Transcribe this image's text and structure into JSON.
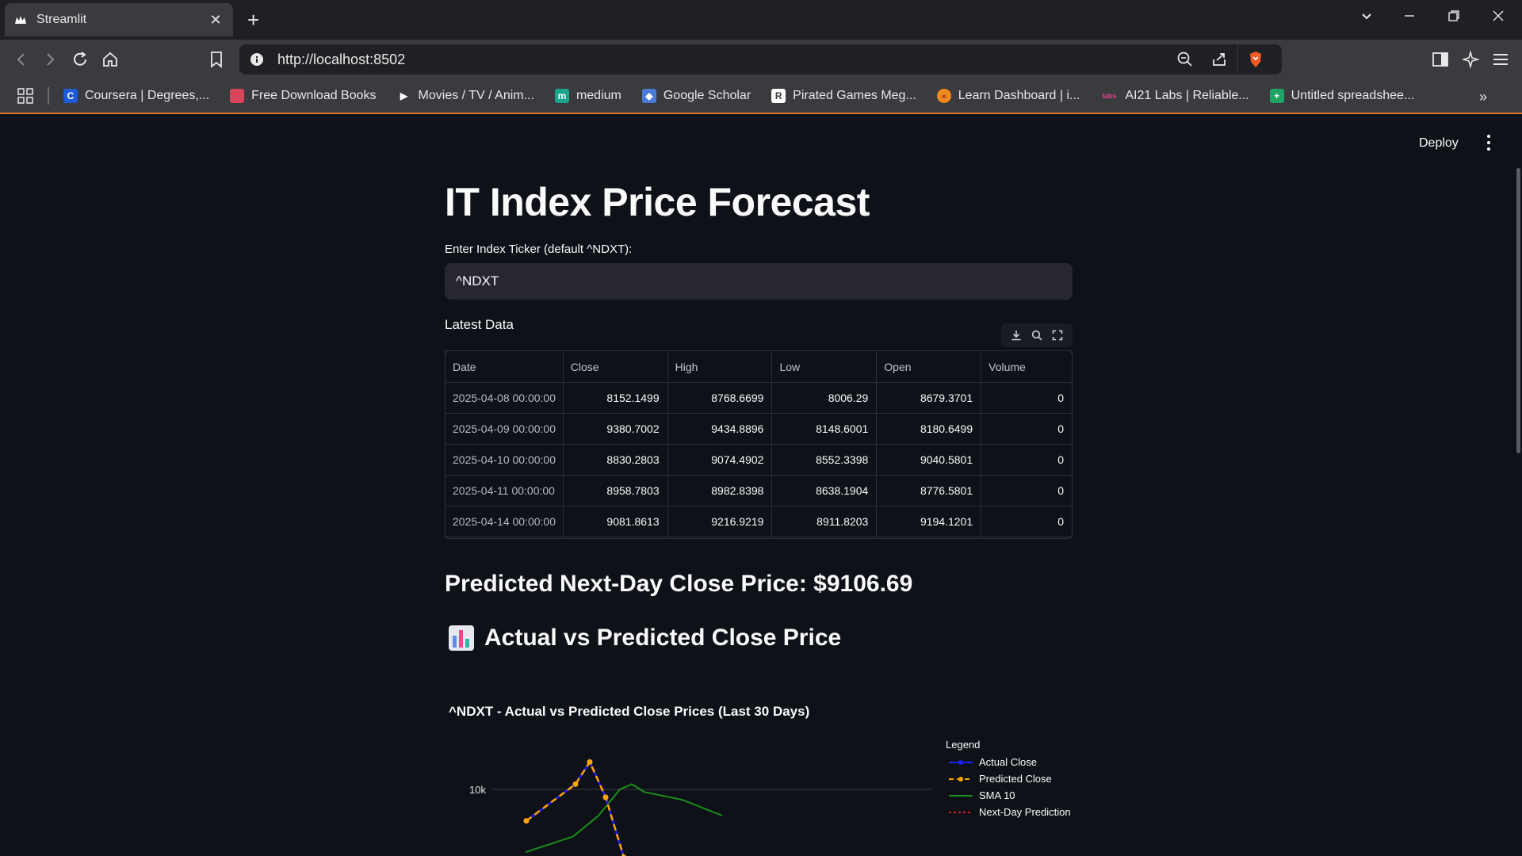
{
  "browser": {
    "tab_title": "Streamlit",
    "url": "http://localhost:8502",
    "bookmarks": [
      {
        "label": "Coursera | Degrees,...",
        "icon": "coursera-icon",
        "color": "#1f5bd8",
        "glyph": "C"
      },
      {
        "label": "Free Download Books",
        "icon": "book-icon",
        "color": "#d9445a",
        "glyph": ""
      },
      {
        "label": "Movies / TV / Anim...",
        "icon": "play-icon",
        "color": "#3a3b3e",
        "glyph": "▶"
      },
      {
        "label": "medium",
        "icon": "medium-icon",
        "color": "#1aa38a",
        "glyph": "m"
      },
      {
        "label": "Google Scholar",
        "icon": "scholar-icon",
        "color": "#4a7bd8",
        "glyph": "◆"
      },
      {
        "label": "Pirated Games Meg...",
        "icon": "games-icon",
        "color": "#ffffff",
        "glyph": "R"
      },
      {
        "label": "Learn Dashboard | i...",
        "icon": "learn-icon",
        "color": "#f08a1c",
        "glyph": "●"
      },
      {
        "label": "AI21 Labs | Reliable...",
        "icon": "ai21-icon",
        "color": "#3a3b3e",
        "glyph": "labs"
      },
      {
        "label": "Untitled spreadshee...",
        "icon": "sheets-icon",
        "color": "#1fa463",
        "glyph": "+"
      }
    ]
  },
  "header": {
    "deploy_label": "Deploy"
  },
  "main": {
    "title": "IT Index Price Forecast",
    "ticker_label": "Enter Index Ticker (default ^NDXT):",
    "ticker_value": "^NDXT",
    "latest_data_label": "Latest Data",
    "predicted_text": "Predicted Next-Day Close Price: $9106.69",
    "chart_header": "Actual vs Predicted Close Price"
  },
  "table": {
    "columns": [
      "Date",
      "Close",
      "High",
      "Low",
      "Open",
      "Volume"
    ],
    "rows": [
      [
        "2025-04-08 00:00:00",
        "8152.1499",
        "8768.6699",
        "8006.29",
        "8679.3701",
        "0"
      ],
      [
        "2025-04-09 00:00:00",
        "9380.7002",
        "9434.8896",
        "8148.6001",
        "8180.6499",
        "0"
      ],
      [
        "2025-04-10 00:00:00",
        "8830.2803",
        "9074.4902",
        "8552.3398",
        "9040.5801",
        "0"
      ],
      [
        "2025-04-11 00:00:00",
        "8958.7803",
        "8982.8398",
        "8638.1904",
        "8776.5801",
        "0"
      ],
      [
        "2025-04-14 00:00:00",
        "9081.8613",
        "9216.9219",
        "8911.8203",
        "9194.1201",
        "0"
      ]
    ]
  },
  "chart_data": {
    "type": "line",
    "title": "^NDXT - Actual vs Predicted Close Prices (Last 30 Days)",
    "legend_title": "Legend",
    "legend_position": "right",
    "y_ticks": [
      "10k"
    ],
    "series": [
      {
        "name": "Actual Close",
        "color": "#1f1fff",
        "style": "solid-marker",
        "values": [
          9760,
          10040,
          10210,
          9940,
          9480
        ]
      },
      {
        "name": "Predicted Close",
        "color": "#ffa500",
        "style": "dashed-marker",
        "values": [
          9760,
          10040,
          10210,
          9940,
          9480
        ]
      },
      {
        "name": "SMA 10",
        "color": "#1a8f1a",
        "style": "solid",
        "values": [
          9520,
          9640,
          9800,
          10000,
          10040,
          9980,
          9920,
          9800
        ]
      },
      {
        "name": "Next-Day Prediction",
        "color": "#e02020",
        "style": "dotted",
        "values": []
      }
    ]
  }
}
